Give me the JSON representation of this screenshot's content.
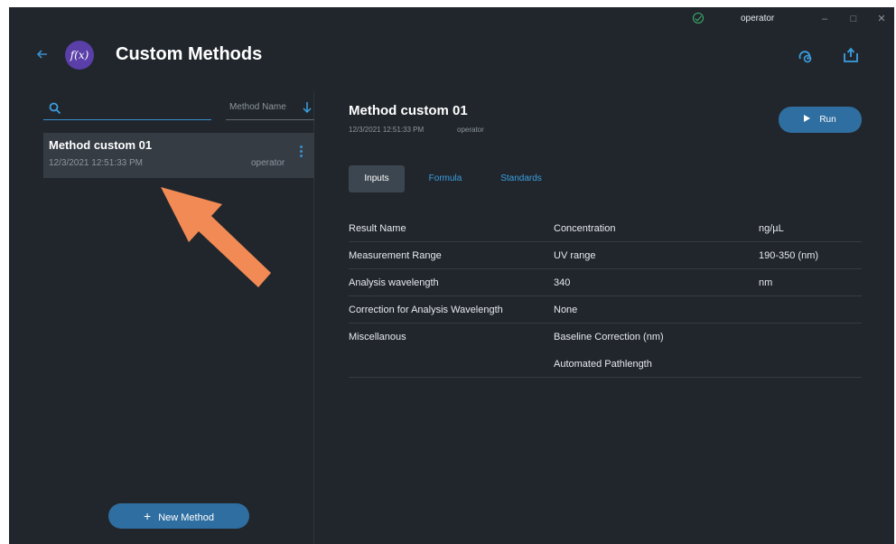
{
  "titlebar": {
    "user": "operator",
    "status_icon": "check-circle-icon",
    "minimize": "–",
    "maximize": "□",
    "close": "✕"
  },
  "header": {
    "logo_text": "f(x)",
    "title": "Custom Methods",
    "icons": [
      "cloud-sync-icon",
      "export-icon"
    ]
  },
  "left_panel": {
    "search": {
      "placeholder": "",
      "value": ""
    },
    "sort": {
      "label": "Method Name",
      "direction": "descending"
    },
    "methods": [
      {
        "name": "Method custom 01",
        "date": "12/3/2021 12:51:33 PM",
        "user": "operator"
      }
    ],
    "new_method_label": "New Method",
    "new_method_icon": "+"
  },
  "detail": {
    "title": "Method custom 01",
    "date": "12/3/2021 12:51:33 PM",
    "user": "operator",
    "run_label": "Run",
    "tabs": [
      {
        "label": "Inputs",
        "active": true
      },
      {
        "label": "Formula",
        "active": false
      },
      {
        "label": "Standards",
        "active": false
      }
    ],
    "rows": [
      {
        "name": "Result Name",
        "value": "Concentration",
        "unit": "ng/µL"
      },
      {
        "name": "Measurement Range",
        "value": "UV range",
        "unit": "190-350 (nm)"
      },
      {
        "name": "Analysis wavelength",
        "value": "340",
        "unit": "nm"
      },
      {
        "name": "Correction for Analysis Wavelength",
        "value": "None",
        "unit": ""
      },
      {
        "name": "Miscellanous",
        "value": "Baseline Correction (nm)",
        "unit": ""
      },
      {
        "name": "",
        "value": "Automated Pathlength",
        "unit": ""
      }
    ]
  },
  "colors": {
    "background": "#21262c",
    "accent": "#2f6ea0",
    "link": "#3a9fe0",
    "annotation_arrow": "#f28a55",
    "logo": "#5a3fa8",
    "status_ok": "#3cb46e"
  }
}
